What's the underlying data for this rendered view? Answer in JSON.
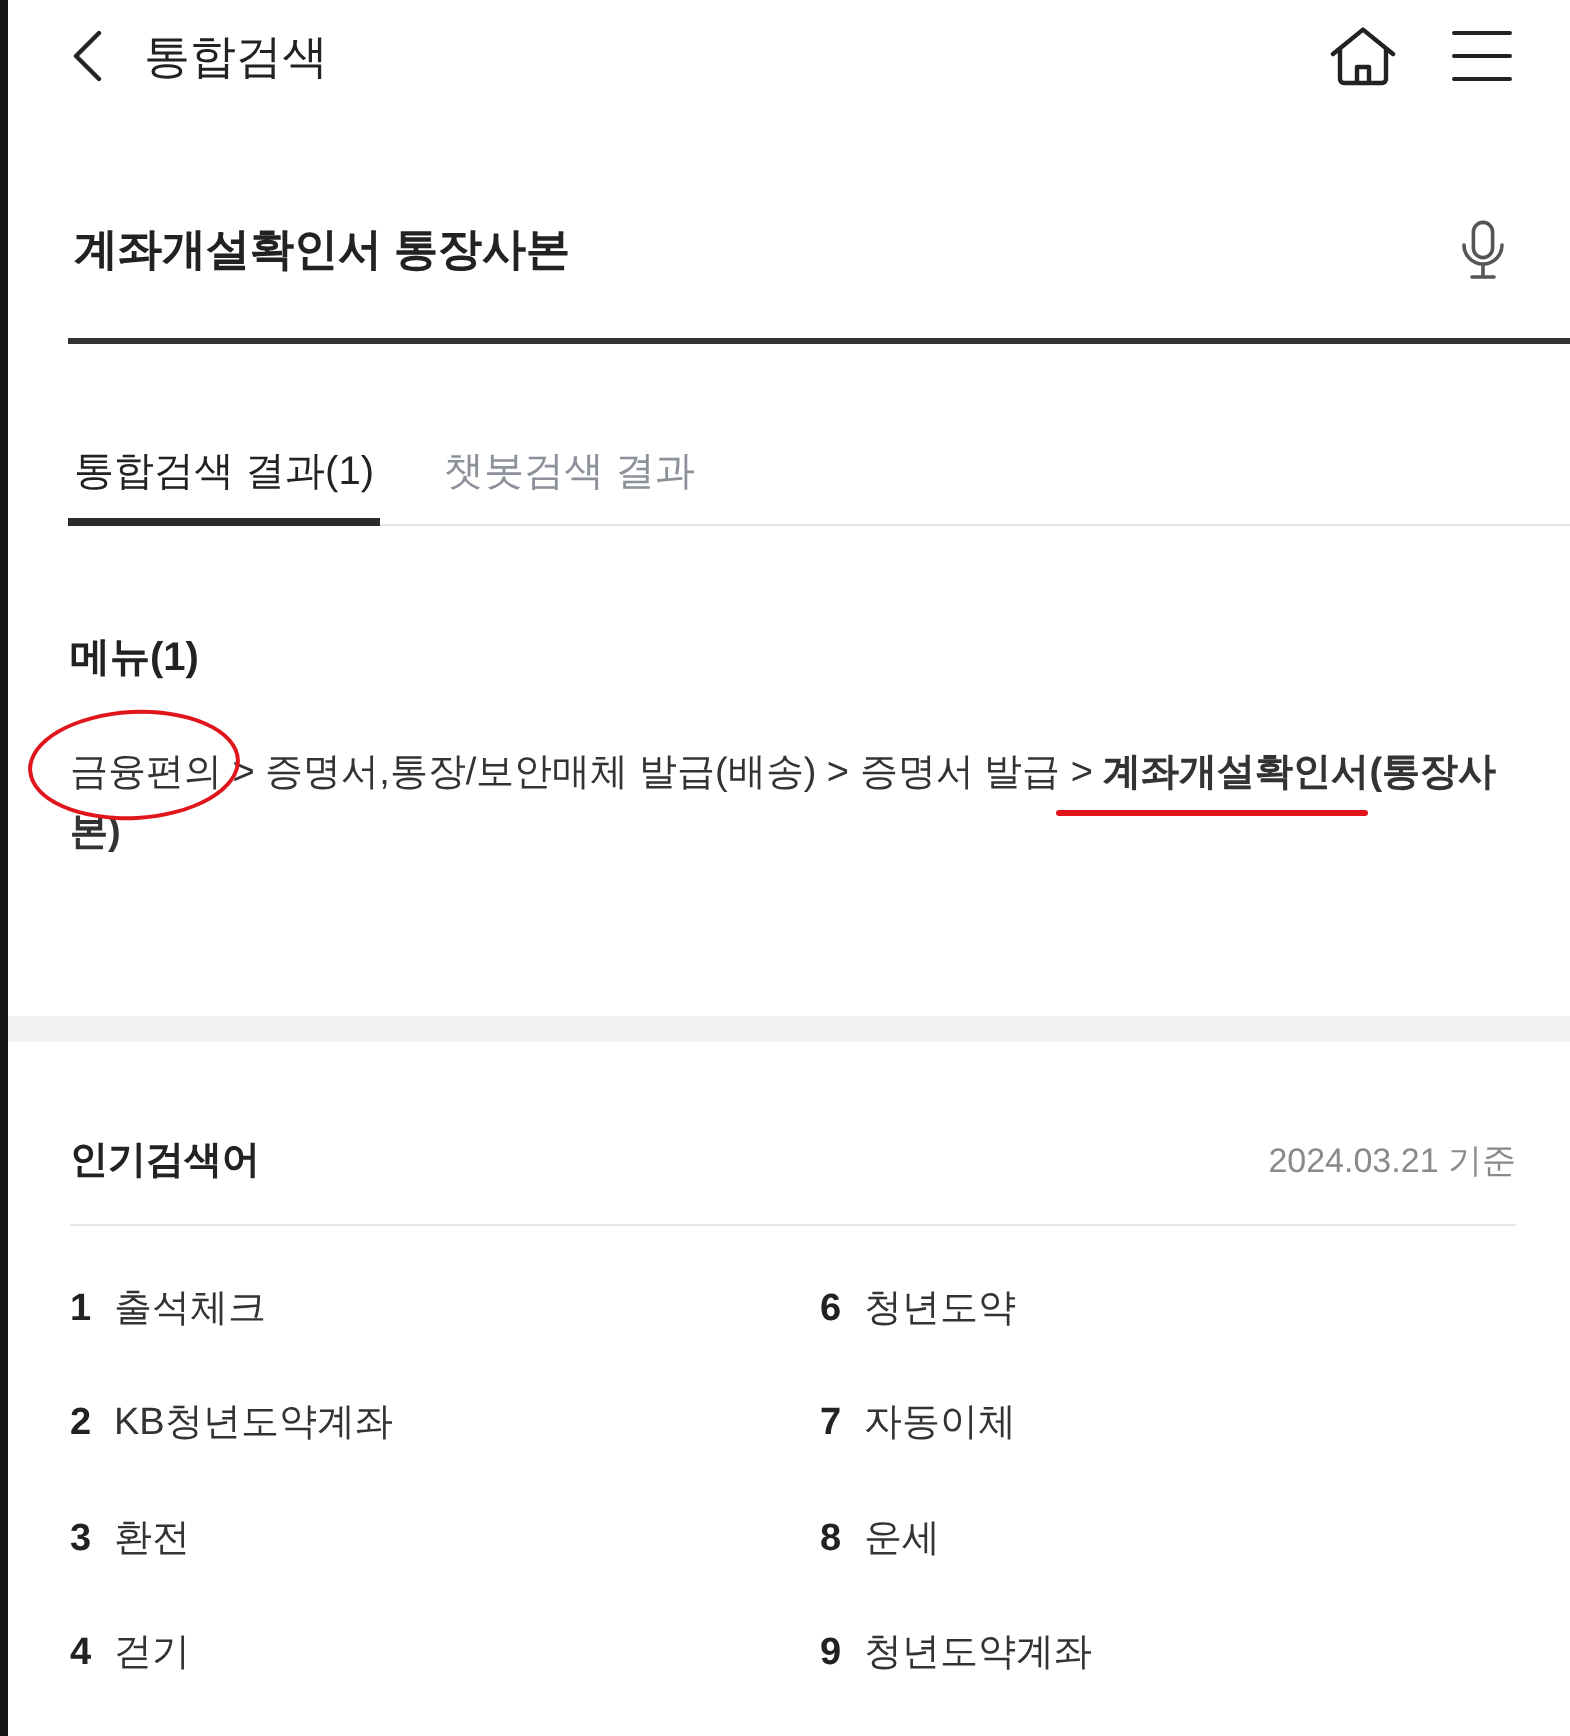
{
  "header": {
    "title": "통합검색"
  },
  "search": {
    "value": "계좌개설확인서 통장사본"
  },
  "tabs": [
    {
      "label": "통합검색 결과(1)",
      "selected": true
    },
    {
      "label": "챗봇검색 결과",
      "selected": false
    }
  ],
  "menu_section": {
    "title": "메뉴(1)",
    "results": [
      {
        "path": "금융편의 > 증명서,통장/보안매체 발급(배송) > 증명서 발급 > **계좌개설확인서(통장사본)**",
        "first_step_circled": true,
        "last_step_underlined": true
      }
    ]
  },
  "popular_searches": {
    "title": "인기검색어",
    "date": "2024.03.21 기준",
    "items": [
      {
        "rank": "1",
        "label": "출석체크"
      },
      {
        "rank": "2",
        "label": "KB청년도약계좌"
      },
      {
        "rank": "3",
        "label": "환전"
      },
      {
        "rank": "4",
        "label": "걷기"
      },
      {
        "rank": "6",
        "label": "청년도약"
      },
      {
        "rank": "7",
        "label": "자동이체"
      },
      {
        "rank": "8",
        "label": "운세"
      },
      {
        "rank": "9",
        "label": "청년도약계좌"
      }
    ]
  }
}
